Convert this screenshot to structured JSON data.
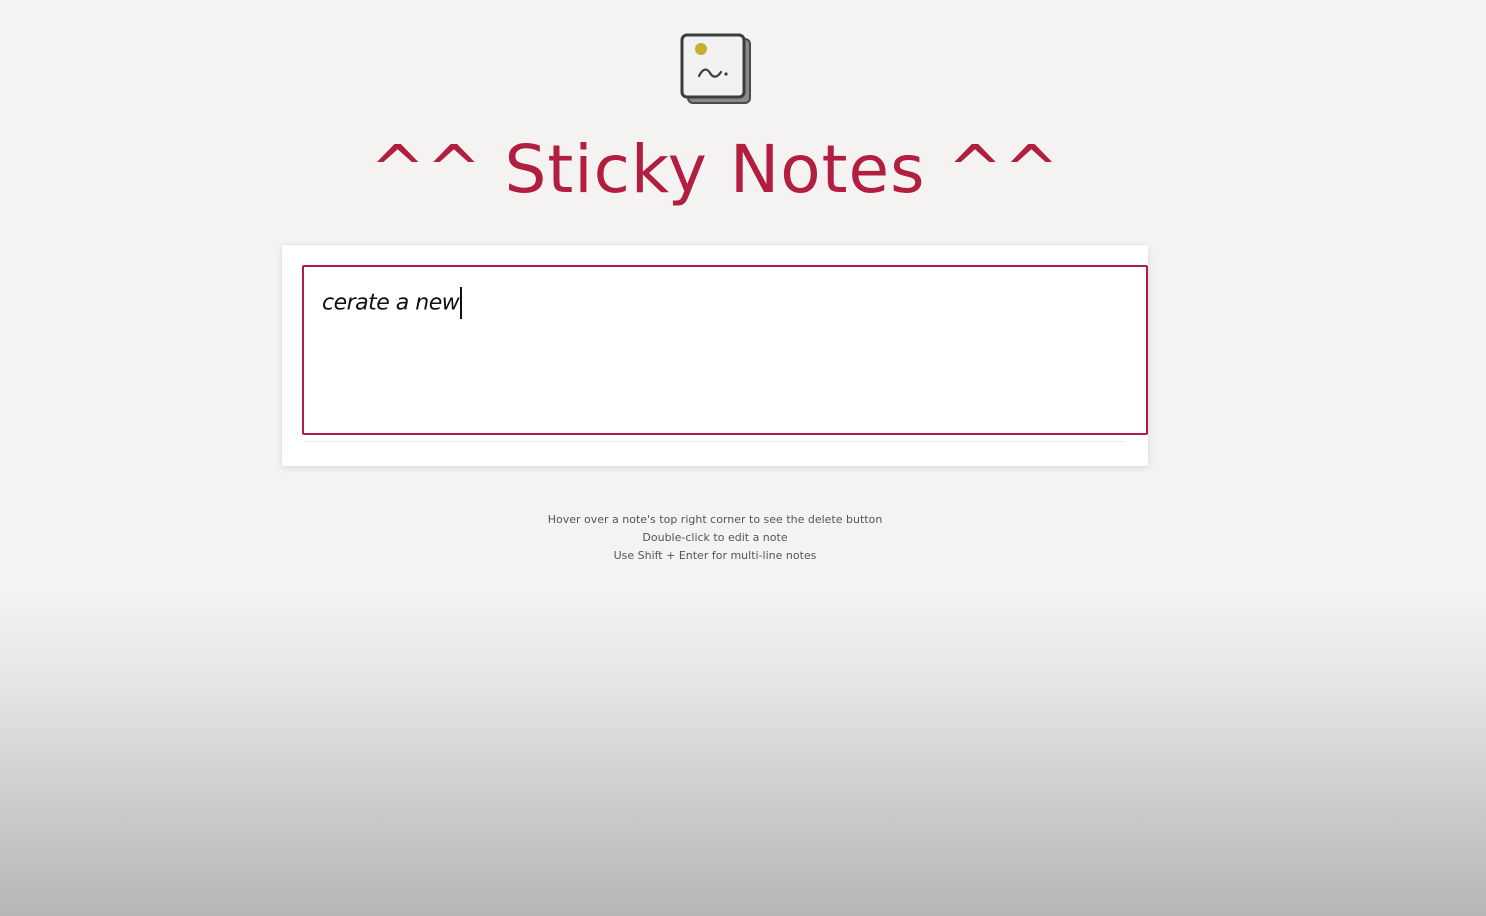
{
  "header": {
    "icon": "sticky-note-icon",
    "title": "^^ Sticky Notes ^^"
  },
  "editor": {
    "current_value": "cerate a new"
  },
  "hints": [
    "Hover over a note's top right corner to see the delete button",
    "Double-click to edit a note",
    "Use Shift + Enter for multi-line notes"
  ],
  "colors": {
    "accent": "#b11e3f",
    "background": "#f4f3f1",
    "icon_dot": "#c4b02e"
  }
}
